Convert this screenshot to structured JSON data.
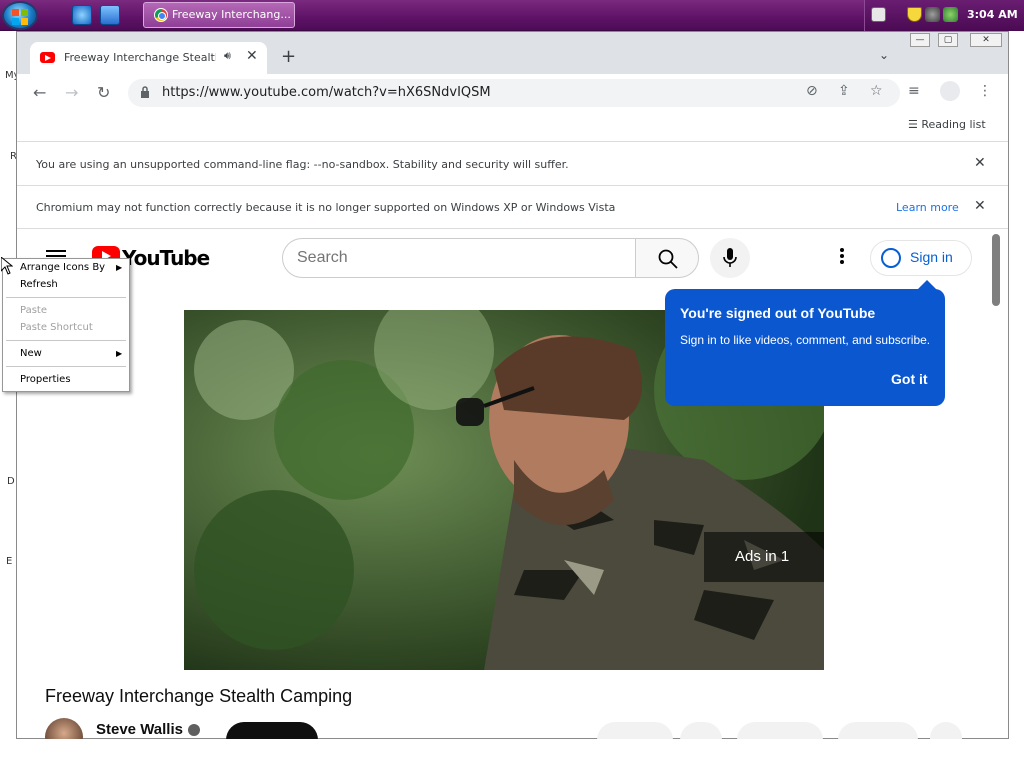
{
  "taskbar": {
    "task_title": "Freeway Interchang...",
    "clock": "3:04 AM"
  },
  "desktop_fragments": [
    "My",
    "R",
    "D",
    "E"
  ],
  "browser": {
    "tab": {
      "title": "Freeway Interchange Stealth Ca",
      "audio_icon": "speaker-icon"
    },
    "new_tab_label": "+",
    "url": "https://www.youtube.com/watch?v=hX6SNdvIQSM",
    "reading_list_label": "Reading list"
  },
  "infobars": [
    {
      "message": "You are using an unsupported command-line flag: --no-sandbox. Stability and security will suffer."
    },
    {
      "message": "Chromium may not function correctly because it is no longer supported on Windows XP or Windows Vista",
      "link": "Learn more"
    }
  ],
  "youtube": {
    "logo_text": "YouTube",
    "search_placeholder": "Search",
    "signin_label": "Sign in",
    "tooltip": {
      "title": "You're signed out of YouTube",
      "body": "Sign in to like videos, comment, and subscribe.",
      "button": "Got it"
    },
    "ads_label": "Ads in 1",
    "video_title": "Freeway Interchange Stealth Camping",
    "channel_name": "Steve Wallis"
  },
  "context_menu": {
    "items": [
      {
        "label": "Arrange Icons By",
        "submenu": true,
        "enabled": true
      },
      {
        "label": "Refresh",
        "submenu": false,
        "enabled": true
      },
      {
        "label": "Paste",
        "submenu": false,
        "enabled": false
      },
      {
        "label": "Paste Shortcut",
        "submenu": false,
        "enabled": false
      },
      {
        "label": "New",
        "submenu": true,
        "enabled": true
      },
      {
        "label": "Properties",
        "submenu": false,
        "enabled": true
      }
    ]
  },
  "colors": {
    "taskbar": "#5e1266",
    "youtube_red": "#ff0000",
    "tooltip_blue": "#0b57d0",
    "link_blue": "#1a73e8"
  }
}
